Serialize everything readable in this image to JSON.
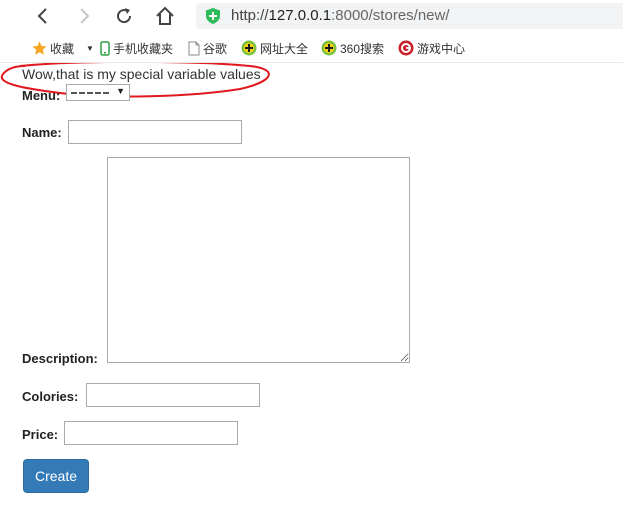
{
  "browser": {
    "url_scheme": "http://",
    "url_host": "127.0.0.1",
    "url_port": ":8000",
    "url_path": "/stores/new/",
    "bookmarks": [
      {
        "label": "收藏",
        "icon": "star-icon"
      },
      {
        "label": "手机收藏夹",
        "icon": "phone-icon"
      },
      {
        "label": "谷歌",
        "icon": "page-icon"
      },
      {
        "label": "网址大全",
        "icon": "plus-circle-icon"
      },
      {
        "label": "360搜索",
        "icon": "plus-circle-icon"
      },
      {
        "label": "游戏中心",
        "icon": "game-icon"
      }
    ]
  },
  "page": {
    "message": "Wow,that is my special variable values",
    "menu_label": "Menu:",
    "name_label": "Name:",
    "description_label": "Description:",
    "colories_label": "Colories:",
    "price_label": "Price:",
    "create_button": "Create"
  },
  "colors": {
    "accent": "#337ab7",
    "annotation": "#e0191f",
    "shield": "#2ebc5b"
  }
}
